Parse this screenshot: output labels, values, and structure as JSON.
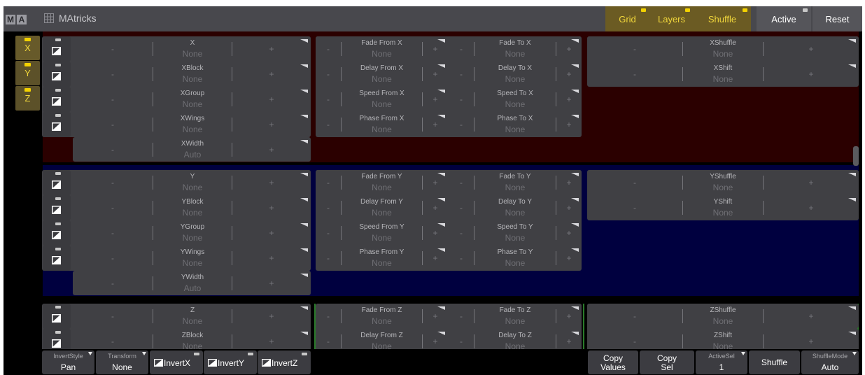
{
  "window": {
    "logo_letters": [
      "M",
      "A"
    ],
    "title": "MAtricks"
  },
  "toolbar": [
    {
      "label": "Grid",
      "style": "yellow"
    },
    {
      "label": "Layers",
      "style": "yellow"
    },
    {
      "label": "Shuffle",
      "style": "yellow"
    },
    {
      "label": "Active",
      "style": "grey"
    },
    {
      "label": "Reset",
      "style": "grey"
    }
  ],
  "axes": [
    "X",
    "Y",
    "Z"
  ],
  "colors": {
    "x_band": "#2b0000",
    "y_band": "#00003f",
    "z_band": "#000000",
    "accent_yellow": "#f0d63b",
    "green_border": "#2a7a2a"
  },
  "cell_minus": "-",
  "cell_plus": "+",
  "sections": [
    {
      "axis": "X",
      "col1": [
        {
          "name": "X",
          "value": "None"
        },
        {
          "name": "XBlock",
          "value": "None"
        },
        {
          "name": "XGroup",
          "value": "None"
        },
        {
          "name": "XWings",
          "value": "None"
        },
        {
          "name": "XWidth",
          "value": "Auto"
        }
      ],
      "col2": [
        {
          "name": "Fade From X",
          "value": "None"
        },
        {
          "name": "Delay From X",
          "value": "None"
        },
        {
          "name": "Speed From X",
          "value": "None"
        },
        {
          "name": "Phase From X",
          "value": "None"
        }
      ],
      "col3": [
        {
          "name": "Fade To X",
          "value": "None"
        },
        {
          "name": "Delay To X",
          "value": "None"
        },
        {
          "name": "Speed To X",
          "value": "None"
        },
        {
          "name": "Phase To X",
          "value": "None"
        }
      ],
      "col4": [
        {
          "name": "XShuffle",
          "value": "None"
        },
        {
          "name": "XShift",
          "value": "None"
        }
      ]
    },
    {
      "axis": "Y",
      "col1": [
        {
          "name": "Y",
          "value": "None"
        },
        {
          "name": "YBlock",
          "value": "None"
        },
        {
          "name": "YGroup",
          "value": "None"
        },
        {
          "name": "YWings",
          "value": "None"
        },
        {
          "name": "YWidth",
          "value": "Auto"
        }
      ],
      "col2": [
        {
          "name": "Fade From Y",
          "value": "None"
        },
        {
          "name": "Delay From Y",
          "value": "None"
        },
        {
          "name": "Speed From Y",
          "value": "None"
        },
        {
          "name": "Phase From Y",
          "value": "None"
        }
      ],
      "col3": [
        {
          "name": "Fade To Y",
          "value": "None"
        },
        {
          "name": "Delay To Y",
          "value": "None"
        },
        {
          "name": "Speed To Y",
          "value": "None"
        },
        {
          "name": "Phase To Y",
          "value": "None"
        }
      ],
      "col4": [
        {
          "name": "YShuffle",
          "value": "None"
        },
        {
          "name": "YShift",
          "value": "None"
        }
      ]
    },
    {
      "axis": "Z",
      "col1": [
        {
          "name": "Z",
          "value": "None"
        },
        {
          "name": "ZBlock",
          "value": "None"
        }
      ],
      "col2": [
        {
          "name": "Fade From Z",
          "value": "None"
        },
        {
          "name": "Delay From Z",
          "value": "None"
        }
      ],
      "col3": [
        {
          "name": "Fade To Z",
          "value": "None"
        },
        {
          "name": "Delay To Z",
          "value": "None"
        }
      ],
      "col4": [
        {
          "name": "ZShuffle",
          "value": "None"
        },
        {
          "name": "ZShift",
          "value": "None"
        }
      ]
    }
  ],
  "bottom": {
    "invert_style": {
      "label": "InvertStyle",
      "value": "Pan"
    },
    "transform": {
      "label": "Transform",
      "value": "None"
    },
    "invert_toggles": [
      "InvertX",
      "InvertY",
      "InvertZ"
    ],
    "copy_values": [
      "Copy",
      "Values"
    ],
    "copy_sel": [
      "Copy",
      "Sel"
    ],
    "active_sel": {
      "label": "ActiveSel",
      "value": "1"
    },
    "shuffle": "Shuffle",
    "shuffle_mode": {
      "label": "ShuffleMode",
      "value": "Auto"
    }
  }
}
